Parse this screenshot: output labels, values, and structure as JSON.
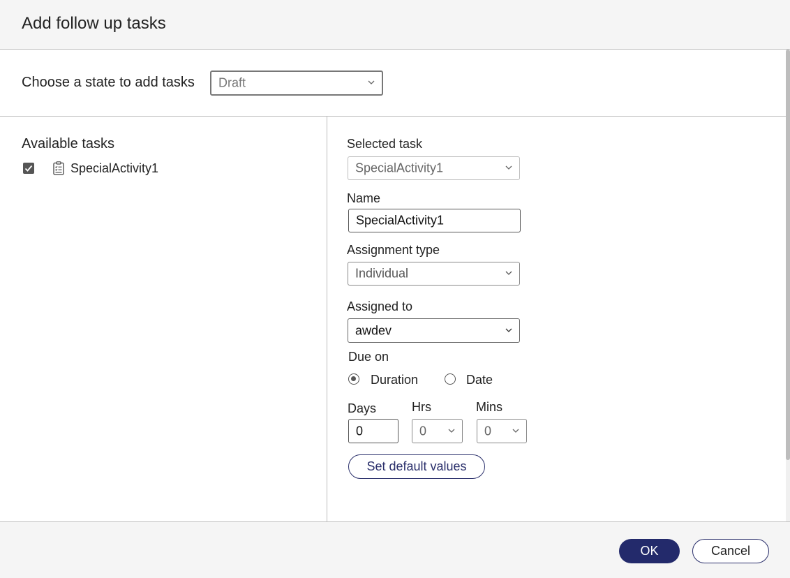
{
  "dialog": {
    "title": "Add follow up tasks"
  },
  "state": {
    "label": "Choose a state to add tasks",
    "selected": "Draft"
  },
  "available": {
    "heading": "Available tasks",
    "tasks": [
      {
        "label": "SpecialActivity1",
        "checked": true
      }
    ]
  },
  "details": {
    "selected_task_label": "Selected task",
    "selected_task_value": "SpecialActivity1",
    "name_label": "Name",
    "name_value": "SpecialActivity1",
    "assignment_type_label": "Assignment type",
    "assignment_type_value": "Individual",
    "assigned_to_label": "Assigned to",
    "assigned_to_value": "awdev",
    "due_on_label": "Due on",
    "due_options": [
      {
        "label": "Duration",
        "selected": true
      },
      {
        "label": "Date",
        "selected": false
      }
    ],
    "days_label": "Days",
    "days_value": "0",
    "hrs_label": "Hrs",
    "hrs_value": "0",
    "mins_label": "Mins",
    "mins_value": "0",
    "set_default_label": "Set default values"
  },
  "footer": {
    "ok_label": "OK",
    "cancel_label": "Cancel"
  },
  "colors": {
    "primary": "#232a6b",
    "header_bg": "#f5f5f5",
    "border": "#bdbdbd",
    "checkbox": "#555555"
  }
}
